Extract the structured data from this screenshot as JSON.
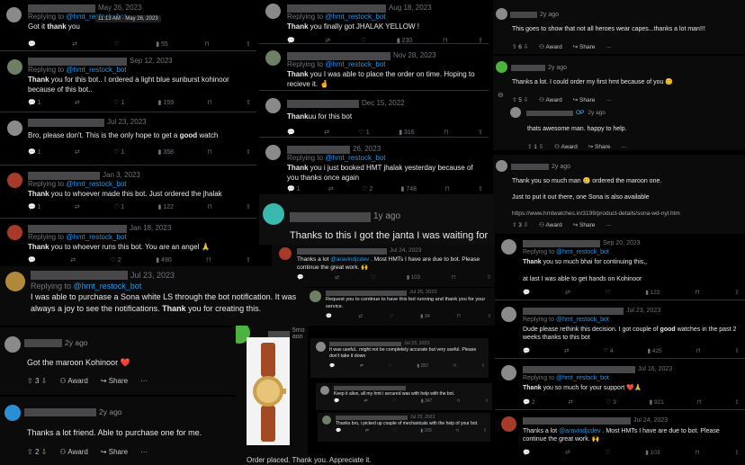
{
  "handle": "@hmt_restock_bot",
  "replying": "Replying to",
  "t1": {
    "date": "May 26, 2023",
    "tooltip": "11:13 AM · May 26, 2023",
    "pre": "Got it ",
    "bold": "thank",
    "post": " you",
    "views": "55"
  },
  "t2": {
    "date": "Sep 12, 2023",
    "bold": "Thank",
    "text": " you for this bot.. I ordered a light blue sunburst kohinoor because of this bot..",
    "r": "1",
    "l": "1",
    "views": "159"
  },
  "t3": {
    "date": "Jul 23, 2023",
    "pre": "Bro, please don't. This is the only hope to get a ",
    "bold": "good",
    "post": " watch",
    "r": "1",
    "l": "1",
    "views": "358"
  },
  "t4": {
    "date": "Jan 3, 2023",
    "bold": "Thank",
    "text": " you to whoever made this bot. Just ordered the jhalak",
    "r": "1",
    "l": "1",
    "views": "122"
  },
  "t5": {
    "date": "Jan 18, 2023",
    "bold": "Thank",
    "text": " you to whoever runs this bot. You are an angel 🙏",
    "l": "2",
    "views": "490"
  },
  "t6": {
    "date": "Jul 23, 2023",
    "pre": "I was able to purchase a Sona white LS through the bot notification. It was always a joy to see the notifications. ",
    "bold": "Thank",
    "post": " you for creating this."
  },
  "t7": {
    "date": "Aug 18, 2023",
    "bold": "Thank",
    "text": " you finally got JHALAK YELLOW !",
    "views": "230"
  },
  "t8": {
    "date": "Nov 28, 2023",
    "bold": "Thank",
    "text": " you I was able to place the order on time. Hoping to recieve it. 🤞",
    "r": "1",
    "views": "281"
  },
  "t9": {
    "date": "Dec 15, 2022",
    "bold": "Thank",
    "text": "uu for this bot",
    "l": "1",
    "views": "316"
  },
  "t10": {
    "date": "26, 2023",
    "bold": "Thank",
    "text": " you i just booked HMT jhalak yesterday because of you thanks once again",
    "r": "1",
    "l": "2",
    "views": "748"
  },
  "r1": {
    "time": "2y ago",
    "text": "Got the maroon Kohinoor ❤️",
    "votes": "3",
    "award": "Award",
    "share": "Share"
  },
  "r2": {
    "time": "2y ago",
    "text": "Thanks a lot friend. Able to purchase one for me.",
    "votes": "2",
    "award": "Award",
    "share": "Share"
  },
  "r3": {
    "time": "1y ago",
    "text": "Thanks to this I got the janta I was waiting for"
  },
  "r4": {
    "time": "5mo ago",
    "text": "Order placed. Thank you. Appreciate it."
  },
  "r5": {
    "time": "2y ago",
    "text": "This goes to show that not all heroes wear capes...thanks a lot man!!!",
    "votes": "6",
    "award": "Award",
    "share": "Share"
  },
  "r6": {
    "time": "2y ago",
    "text": "Thanks a lot. I could order my first hmt because of you 😊",
    "votes": "5",
    "award": "Award",
    "share": "Share"
  },
  "r7": {
    "op": "OP",
    "time": "2y ago",
    "text": "thats awesome man. happy to help.",
    "votes": "1",
    "award": "Award",
    "share": "Share"
  },
  "r8": {
    "time": "2y ago",
    "text1": "Thank you so much man 🥲 ordered the maroon one.",
    "text2": "Just to put it out there, one Sona is also available",
    "link": "https://www.hmtwatches.in/3199/product-details/sona-wd-nyl.htm",
    "votes": "3",
    "award": "Award",
    "share": "Share"
  },
  "t11": {
    "date": "Jul 24, 2023",
    "pre": "Thanks a lot ",
    "mention": "@aravindjcdev",
    "post": " . Most HMTs I have are due to bot. Please continue the great work. 🙌",
    "views": "103"
  },
  "t12": {
    "date": "Jul 25, 2023",
    "text": "Request you to continue to have this bot running and thank you for your service.",
    "views": "34"
  },
  "t13": {
    "date": "Jul 23, 2023",
    "text": "It was useful.. might not be completely accurate but very useful. Please don't take it down",
    "views": "282"
  },
  "t14": {
    "text": "Keep it alive, all my hmt i secured was with help with the bot.",
    "views": "347"
  },
  "t15": {
    "date": "Jul 23, 2023",
    "text": "Thanks bro, i picked up couple of mechanicals with the help of your bot.",
    "views": "165"
  },
  "t16": {
    "date": "Sep 20, 2023",
    "bold": "Thank",
    "text": " you so much bhai for continuing this,,",
    "text2": "at last I was able to get hands on Kohinoor",
    "views": "122"
  },
  "t17": {
    "date": "Jul 23, 2023",
    "pre": "Dude please rethink this decision. I got couple of ",
    "bold": "good",
    "post": " watches in the past 2 weeks thanks to this bot",
    "l": "4",
    "views": "425"
  },
  "t18": {
    "date": "Jul 16, 2023",
    "bold": "Thank",
    "text": " you so much for your support ❤️🙏",
    "r": "2",
    "l": "3",
    "views": "921"
  },
  "t19": {
    "date": "Jul 24, 2023",
    "pre": "Thanks a lot ",
    "mention": "@aravindjcdev",
    "post": " . Most HMTs I have are due to bot. Please continue the great work. 🙌",
    "views": "103"
  }
}
